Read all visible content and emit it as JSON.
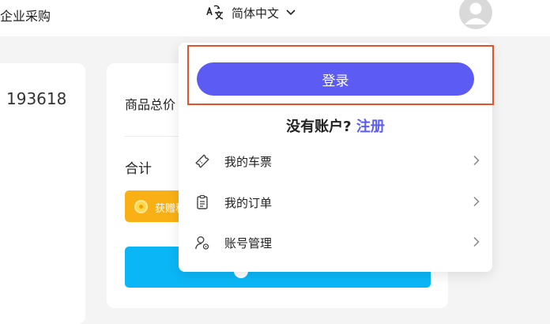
{
  "header": {
    "nav_link": "企业采购",
    "language": {
      "label": "简体中文",
      "icon": "translate-icon",
      "chevron": "chevron-down-icon"
    },
    "avatar": "user-avatar-icon"
  },
  "page": {
    "order_number": "193618",
    "total_label": "商品总价",
    "sum_label": "合计",
    "gift_text": "获赠积分"
  },
  "dropdown": {
    "login_label": "登录",
    "no_account_text": "没有账户?",
    "register_label": "注册",
    "menu": [
      {
        "label": "我的车票",
        "icon": "ticket-icon"
      },
      {
        "label": "我的订单",
        "icon": "order-list-icon"
      },
      {
        "label": "账号管理",
        "icon": "account-settings-icon"
      }
    ]
  },
  "colors": {
    "primary": "#5c5cf5",
    "highlight": "#e2522f",
    "pay": "#0bb6f6",
    "gift": "#f9b014"
  }
}
